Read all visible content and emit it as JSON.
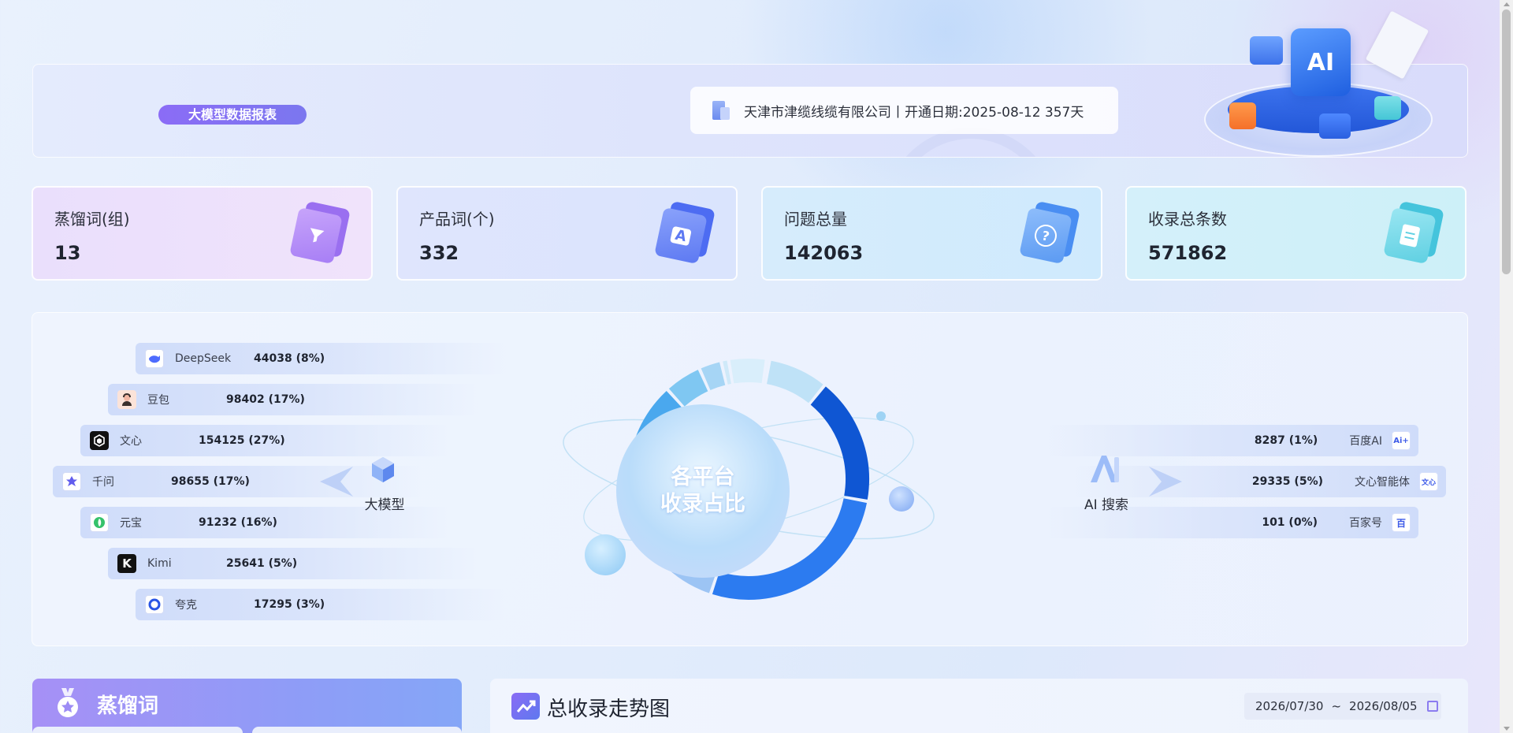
{
  "banner": {
    "tag": "大模型数据报表",
    "company_info": "天津市津缆线缆有限公司丨开通日期:2025-08-12 357天",
    "illustration_text": "AI"
  },
  "stats": [
    {
      "label": "蒸馏词(组)",
      "value": "13",
      "icon": "funnel-icon"
    },
    {
      "label": "产品词(个)",
      "value": "332",
      "icon": "letter-a-icon"
    },
    {
      "label": "问题总量",
      "value": "142063",
      "icon": "question-icon"
    },
    {
      "label": "收录总条数",
      "value": "571862",
      "icon": "document-icon"
    }
  ],
  "platforms": {
    "center_line1": "各平台",
    "center_line2": "收录占比",
    "left_group_label": "大模型",
    "right_group_label": "AI 搜索",
    "left": [
      {
        "name": "DeepSeek",
        "count": "44038 (8%)",
        "share": 0.08,
        "color": "#4d6bfe",
        "icon": "whale-icon"
      },
      {
        "name": "豆包",
        "count": "98402 (17%)",
        "share": 0.17,
        "color": "#f3b7a4",
        "icon": "avatar-icon"
      },
      {
        "name": "文心",
        "count": "154125 (27%)",
        "share": 0.27,
        "color": "#1a1a1a",
        "icon": "hexagon-icon"
      },
      {
        "name": "千问",
        "count": "98655 (17%)",
        "share": 0.17,
        "color": "#615ced",
        "icon": "star-knot-icon"
      },
      {
        "name": "元宝",
        "count": "91232 (16%)",
        "share": 0.16,
        "color": "#35c26b",
        "icon": "leaf-icon"
      },
      {
        "name": "Kimi",
        "count": "25641 (5%)",
        "share": 0.05,
        "color": "#111111",
        "icon": "letter-k-icon"
      },
      {
        "name": "夸克",
        "count": "17295 (3%)",
        "share": 0.03,
        "color": "#2a55e5",
        "icon": "ring-icon"
      }
    ],
    "right": [
      {
        "name": "百度AI",
        "count": "8287 (1%)",
        "share": 0.01,
        "logo_text": "Ai+",
        "icon": "baidu-ai-icon"
      },
      {
        "name": "文心智能体",
        "count": "29335 (5%)",
        "share": 0.05,
        "logo_text": "文心",
        "icon": "wenxin-agent-icon"
      },
      {
        "name": "百家号",
        "count": "101 (0%)",
        "share": 0.0,
        "logo_text": "百",
        "icon": "baijiahao-icon"
      }
    ]
  },
  "keyword_panel": {
    "title": "蒸馏词"
  },
  "trend_panel": {
    "title": "总收录走势图",
    "date_start": "2026/07/30",
    "date_sep": "~",
    "date_end": "2026/08/05"
  }
}
